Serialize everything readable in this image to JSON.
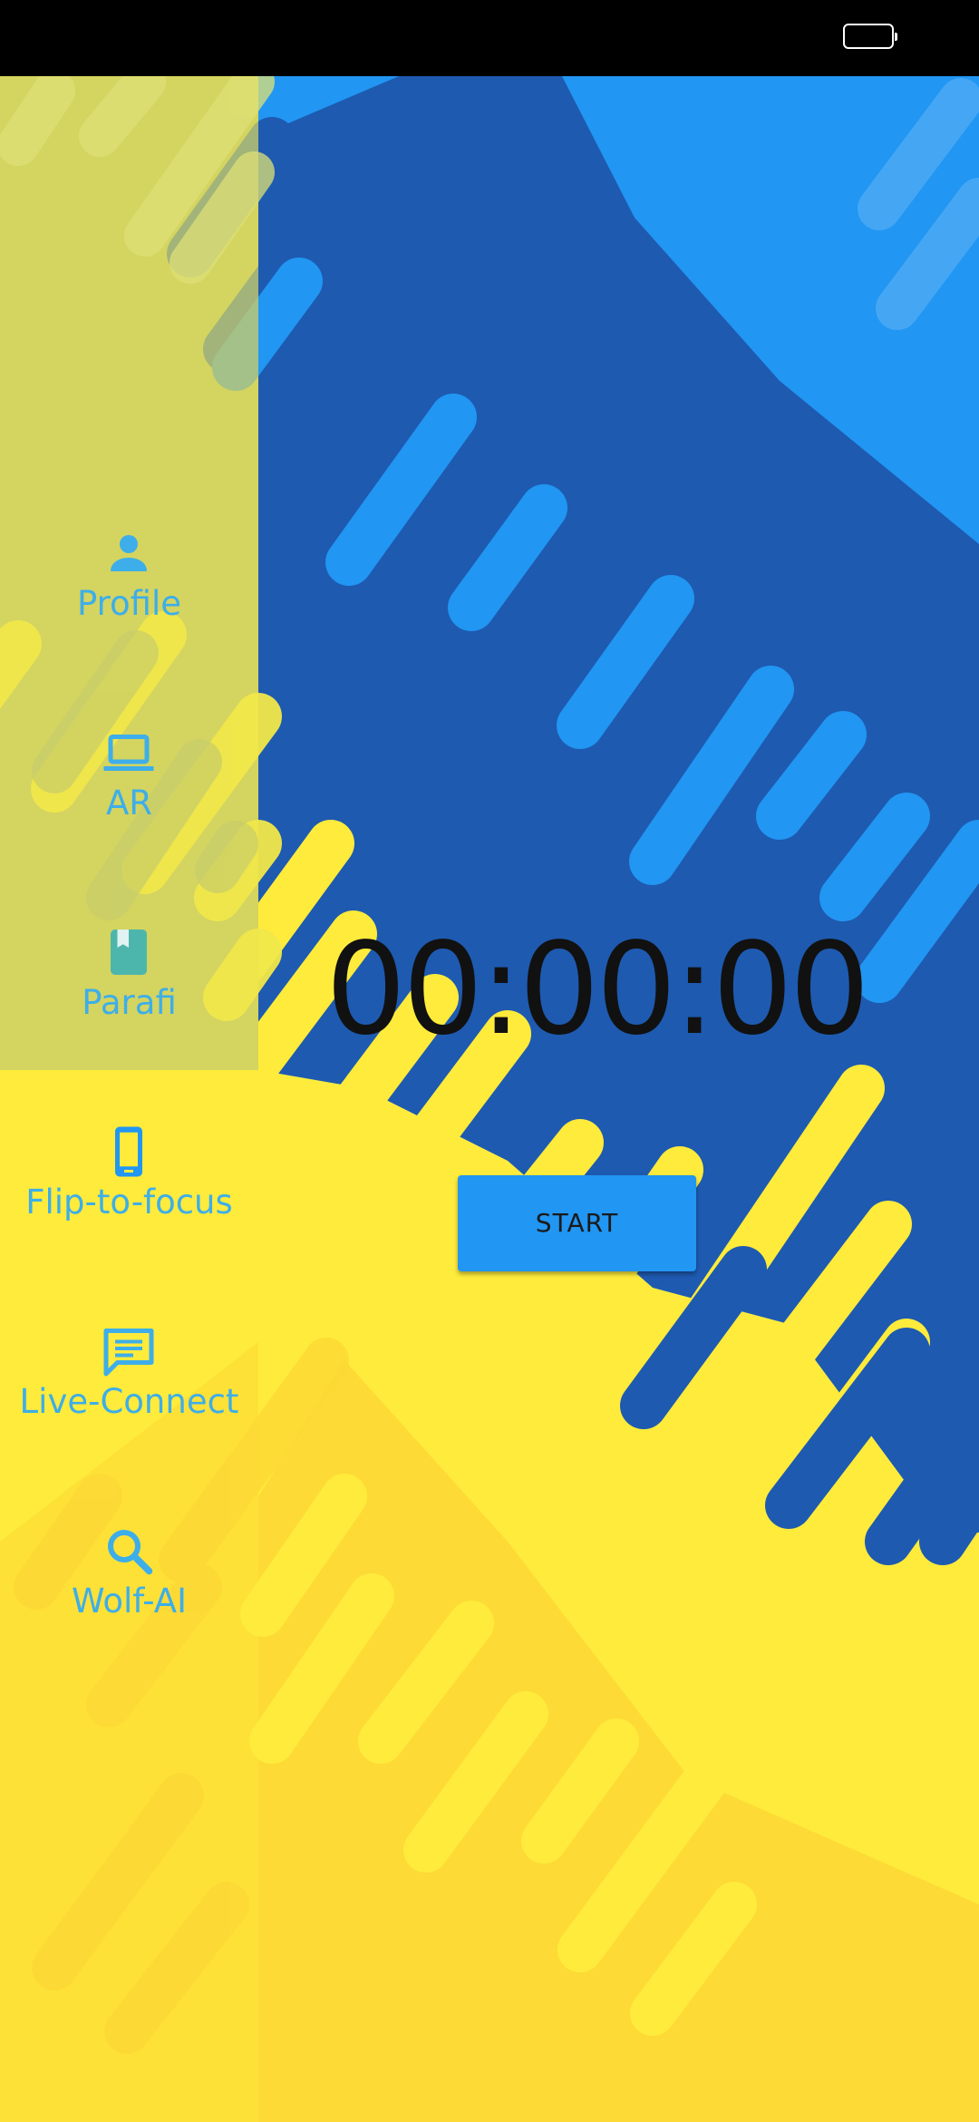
{
  "sidebar": {
    "items": [
      {
        "label": "Profile",
        "icon": "person-icon"
      },
      {
        "label": "AR",
        "icon": "laptop-icon"
      },
      {
        "label": "Parafi",
        "icon": "book-icon"
      },
      {
        "label": "Flip-to-focus",
        "icon": "phone-icon"
      },
      {
        "label": "Live-Connect",
        "icon": "chat-icon"
      },
      {
        "label": "Wolf-AI",
        "icon": "search-icon"
      }
    ]
  },
  "timer": {
    "value": "00:00:00"
  },
  "controls": {
    "start_label": "START"
  },
  "colors": {
    "background_yellow": "#ffeb3b",
    "background_blue": "#2196f3",
    "dark_blue": "#1e5ab0",
    "sidebar_overlay": "#d4d85a",
    "label_color": "#3daee9",
    "button": "#2196f3"
  }
}
